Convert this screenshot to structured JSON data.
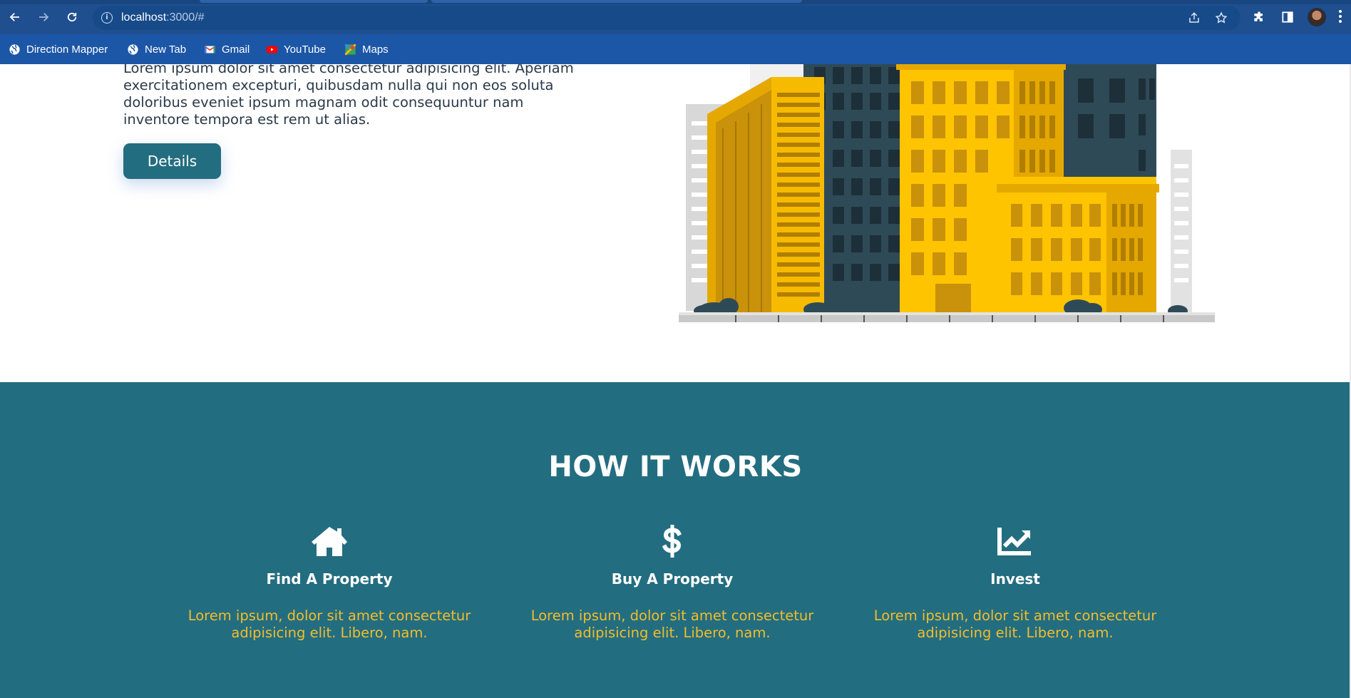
{
  "browser": {
    "url_host": "localhost",
    "url_rest": ":3000/#",
    "bookmarks": [
      {
        "label": "Direction Mapper",
        "icon": "globe-icon"
      },
      {
        "label": "New Tab",
        "icon": "globe-icon"
      },
      {
        "label": "Gmail",
        "icon": "gmail-icon"
      },
      {
        "label": "YouTube",
        "icon": "youtube-icon"
      },
      {
        "label": "Maps",
        "icon": "maps-icon"
      }
    ]
  },
  "hero": {
    "paragraph": "Lorem ipsum dolor sit amet consectetur adipisicing elit. Aperiam exercitationem excepturi, quibusdam nulla qui non eos soluta doloribus eveniet ipsum magnam odit consequuntur nam inventore tempora est rem ut alias.",
    "button_label": "Details"
  },
  "how_it_works": {
    "title": "HOW IT WORKS",
    "items": [
      {
        "icon": "house-icon",
        "title": "Find A Property",
        "text": "Lorem ipsum, dolor sit amet consectetur adipisicing elit. Libero, nam."
      },
      {
        "icon": "dollar-icon",
        "title": "Buy A Property",
        "text": "Lorem ipsum, dolor sit amet consectetur adipisicing elit. Libero, nam."
      },
      {
        "icon": "chart-line-icon",
        "title": "Invest",
        "text": "Lorem ipsum, dolor sit amet consectetur adipisicing elit. Libero, nam."
      }
    ]
  },
  "colors": {
    "chrome": "#1f4f8f",
    "bookmarks_bar": "#1c56a6",
    "teal": "#236d80",
    "accent_yellow": "#f2bd2a",
    "building_yellow": "#ffc400",
    "building_dark": "#2f4a57"
  }
}
